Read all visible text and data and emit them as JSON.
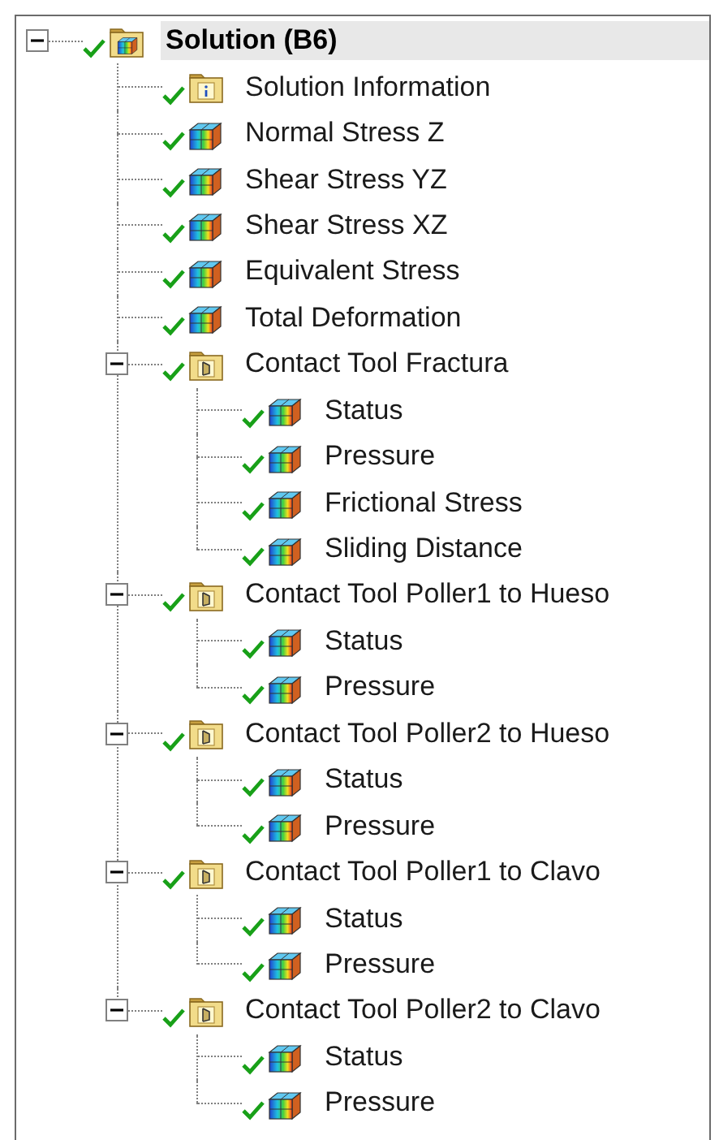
{
  "tree": [
    {
      "label": "Solution (B6)",
      "kind": "solution",
      "selected": true,
      "expanded": true,
      "children": [
        {
          "label": "Solution Information",
          "kind": "info",
          "selected": false
        },
        {
          "label": "Normal Stress Z",
          "kind": "result",
          "selected": false
        },
        {
          "label": "Shear Stress YZ",
          "kind": "result",
          "selected": false
        },
        {
          "label": "Shear Stress XZ",
          "kind": "result",
          "selected": false
        },
        {
          "label": "Equivalent Stress",
          "kind": "result",
          "selected": false
        },
        {
          "label": "Total Deformation",
          "kind": "result",
          "selected": false
        },
        {
          "label": "Contact Tool Fractura",
          "kind": "contact",
          "selected": false,
          "expanded": true,
          "children": [
            {
              "label": "Status",
              "kind": "result",
              "selected": false
            },
            {
              "label": "Pressure",
              "kind": "result",
              "selected": false
            },
            {
              "label": "Frictional Stress",
              "kind": "result",
              "selected": false
            },
            {
              "label": "Sliding Distance",
              "kind": "result",
              "selected": false
            }
          ]
        },
        {
          "label": "Contact Tool Poller1 to Hueso",
          "kind": "contact",
          "selected": false,
          "expanded": true,
          "children": [
            {
              "label": "Status",
              "kind": "result",
              "selected": false
            },
            {
              "label": "Pressure",
              "kind": "result",
              "selected": false
            }
          ]
        },
        {
          "label": "Contact Tool Poller2 to Hueso",
          "kind": "contact",
          "selected": false,
          "expanded": true,
          "children": [
            {
              "label": "Status",
              "kind": "result",
              "selected": false
            },
            {
              "label": "Pressure",
              "kind": "result",
              "selected": false
            }
          ]
        },
        {
          "label": "Contact Tool Poller1 to Clavo",
          "kind": "contact",
          "selected": false,
          "expanded": true,
          "children": [
            {
              "label": "Status",
              "kind": "result",
              "selected": false
            },
            {
              "label": "Pressure",
              "kind": "result",
              "selected": false
            }
          ]
        },
        {
          "label": "Contact Tool Poller2 to Clavo",
          "kind": "contact",
          "selected": false,
          "expanded": true,
          "children": [
            {
              "label": "Status",
              "kind": "result",
              "selected": false
            },
            {
              "label": "Pressure",
              "kind": "result",
              "selected": false
            }
          ]
        }
      ]
    }
  ]
}
